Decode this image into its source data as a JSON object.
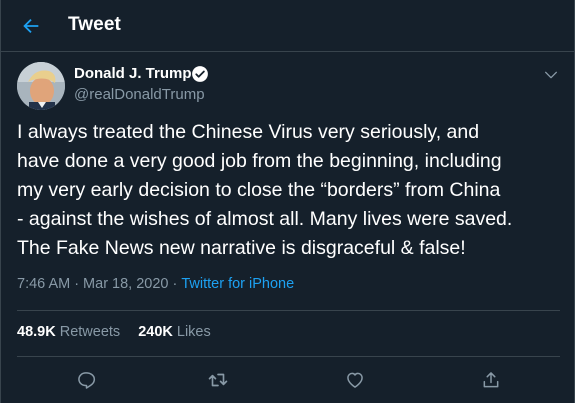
{
  "topbar": {
    "title": "Tweet",
    "back_icon": "arrow-left-icon"
  },
  "author": {
    "name": "Donald J. Trump",
    "handle": "@realDonaldTrump",
    "verified": true
  },
  "tweet": {
    "lines": [
      "I always treated the Chinese Virus very seriously, and",
      "have done a very good job from the beginning, including",
      "my very early decision to close the “borders” from China",
      "- against the wishes of almost all. Many lives were saved.",
      "The Fake News new narrative is disgraceful & false!"
    ]
  },
  "meta": {
    "time": "7:46 AM",
    "date": "Mar 18, 2020",
    "separator": "·",
    "source": "Twitter for iPhone"
  },
  "stats": {
    "retweets_count": "48.9K",
    "retweets_label": "Retweets",
    "likes_count": "240K",
    "likes_label": "Likes"
  },
  "colors": {
    "background": "#15202b",
    "border": "#38444d",
    "secondary_text": "#8899a6",
    "accent": "#1da1f2"
  }
}
